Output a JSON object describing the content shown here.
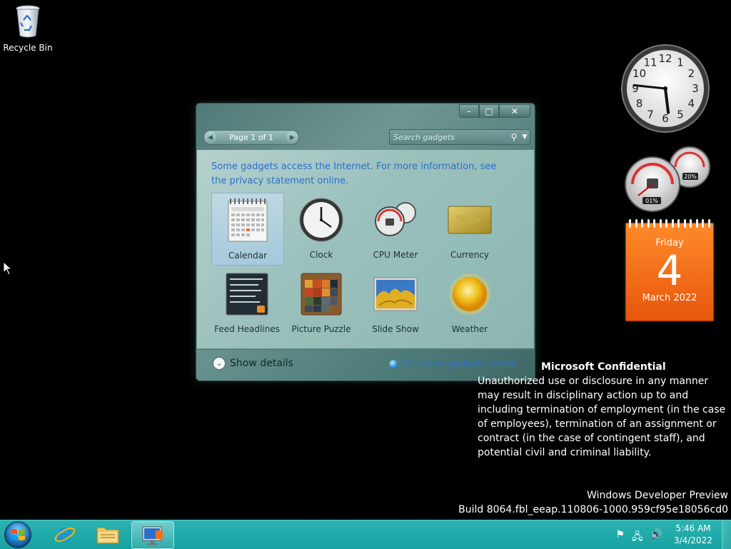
{
  "desktop": {
    "icons": [
      {
        "label": "Recycle Bin",
        "icon": "recycle-bin-icon"
      }
    ]
  },
  "clock_gadget": {
    "time": "5:46",
    "numbers": [
      "12",
      "1",
      "2",
      "3",
      "4",
      "5",
      "6",
      "7",
      "8",
      "9",
      "10",
      "11"
    ]
  },
  "cpu_gadget": {
    "cpu": "01%",
    "memory": "20%"
  },
  "calendar_gadget": {
    "weekday": "Friday",
    "day": "4",
    "month_year": "March 2022"
  },
  "gallery": {
    "buttons": {
      "minimize": "–",
      "maximize": "□",
      "close": "✕"
    },
    "pager": {
      "prev": "◀",
      "label": "Page 1 of 1",
      "next": "▶"
    },
    "search": {
      "placeholder": "Search gadgets"
    },
    "notice": "Some gadgets access the Internet.  For more information, see the privacy statement online.",
    "gadgets": [
      {
        "name": "Calendar",
        "icon": "calendar-icon",
        "selected": true
      },
      {
        "name": "Clock",
        "icon": "clock-icon"
      },
      {
        "name": "CPU Meter",
        "icon": "cpu-meter-icon"
      },
      {
        "name": "Currency",
        "icon": "currency-icon"
      },
      {
        "name": "Feed Headlines",
        "icon": "feed-headlines-icon"
      },
      {
        "name": "Picture Puzzle",
        "icon": "picture-puzzle-icon"
      },
      {
        "name": "Slide Show",
        "icon": "slide-show-icon"
      },
      {
        "name": "Weather",
        "icon": "weather-icon"
      }
    ],
    "show_details": "Show details",
    "get_more": "Get more gadgets online"
  },
  "watermark": {
    "title": "Microsoft Confidential",
    "body": "Unauthorized use or disclosure in any manner may result in disciplinary action up to and including termination of employment (in the case of employees), termination of an assignment or contract (in the case of contingent staff), and potential civil and criminal liability.",
    "edition": "Windows Developer Preview",
    "build": "Build 8064.fbl_eeap.110806-1000.959cf95e18056cd0"
  },
  "taskbar": {
    "pinned": [
      {
        "name": "internet-explorer",
        "icon": "internet-explorer-icon"
      },
      {
        "name": "file-explorer",
        "icon": "folder-icon"
      },
      {
        "name": "desktop-gadgets",
        "icon": "gadgets-icon"
      }
    ],
    "clock_time": "5:46 AM",
    "clock_date": "3/4/2022"
  },
  "colors": {
    "taskbar": "#1fa9a8",
    "link": "#2a6fc9",
    "calendar": "#f07020"
  }
}
